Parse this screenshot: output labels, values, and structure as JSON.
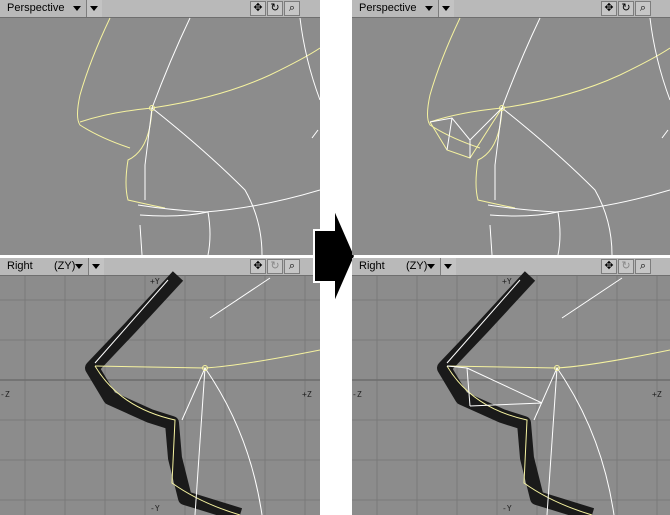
{
  "viewports": {
    "top_left": {
      "view": "Perspective"
    },
    "bottom_left": {
      "view": "Right",
      "axes": "(ZY)",
      "axis_labels": {
        "top": "+Y",
        "bottom": "-Y",
        "right": "+Z",
        "left": "-Z"
      }
    },
    "top_right": {
      "view": "Perspective"
    },
    "bottom_right": {
      "view": "Right",
      "axes": "(ZY)",
      "axis_labels": {
        "top": "+Y",
        "bottom": "-Y",
        "right": "+Z",
        "left": "-Z"
      }
    }
  },
  "icons": {
    "move": "move-icon",
    "rotate": "rotate-icon",
    "zoom": "magnifier-icon",
    "transition": "right-arrow-icon"
  },
  "colors": {
    "viewport_bg": "#8c8c8c",
    "grid": "#7a7a7a",
    "wire": "#ffffff",
    "selected_wire": "#f6f3a0",
    "header": "#b9b9b9"
  }
}
